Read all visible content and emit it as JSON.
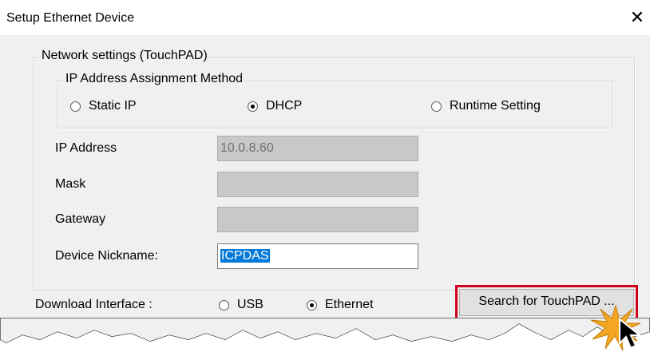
{
  "window": {
    "title": "Setup Ethernet Device",
    "close_symbol": "✕"
  },
  "network_group": {
    "legend": "Network settings (TouchPAD)"
  },
  "ip_method": {
    "legend": "IP Address Assignment Method",
    "options": [
      {
        "label": "Static IP",
        "selected": false
      },
      {
        "label": "DHCP",
        "selected": true
      },
      {
        "label": "Runtime Setting",
        "selected": false
      }
    ]
  },
  "fields": {
    "ip_address": {
      "label": "IP Address",
      "value": "10.0.8.60",
      "enabled": false
    },
    "mask": {
      "label": "Mask",
      "value": "",
      "enabled": false
    },
    "gateway": {
      "label": "Gateway",
      "value": "",
      "enabled": false
    },
    "nickname": {
      "label": "Device Nickname:",
      "value": "ICPDAS",
      "enabled": true
    }
  },
  "download": {
    "label": "Download Interface :",
    "options": [
      {
        "label": "USB",
        "selected": false
      },
      {
        "label": "Ethernet",
        "selected": true
      }
    ]
  },
  "search_button": {
    "label": "Search for TouchPAD ..."
  },
  "colors": {
    "highlight": "#d0021b",
    "selection": "#0078d7",
    "starburst": "#f5a623"
  },
  "icons": {
    "cursor": "mouse-pointer-icon",
    "click_effect": "click-starburst-icon"
  }
}
